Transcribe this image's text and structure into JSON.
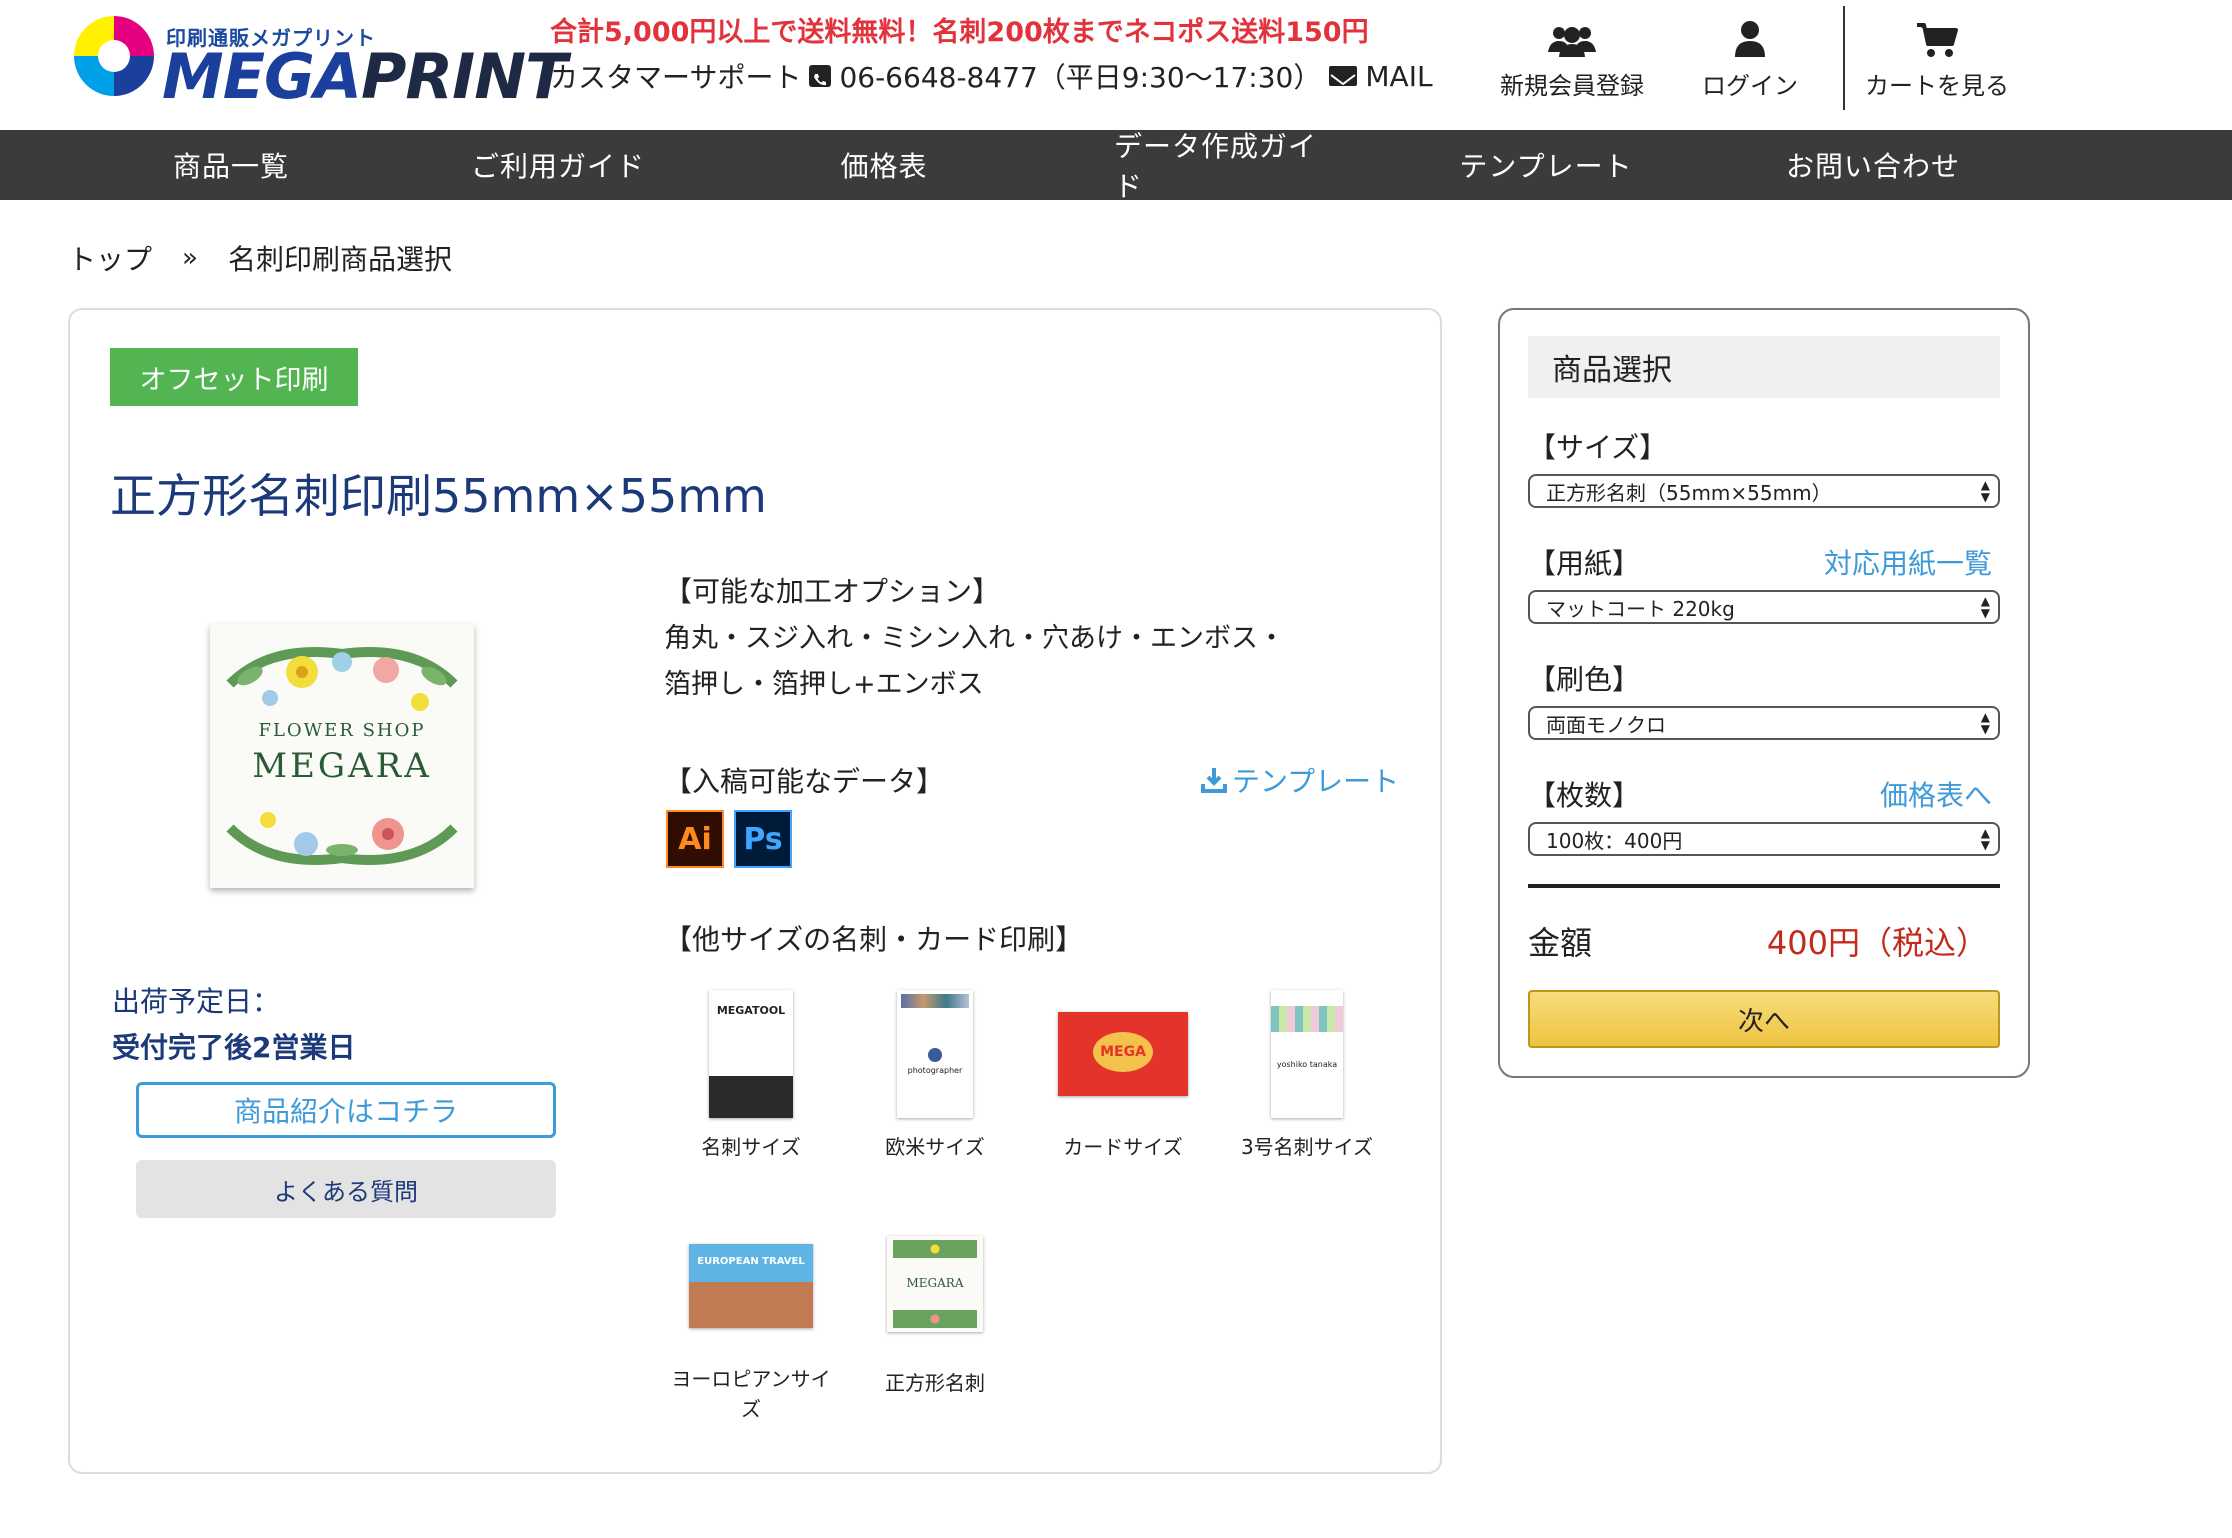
{
  "header": {
    "logo_tagline": "印刷通販メガプリント",
    "logo_mega": "MEGA",
    "logo_print": "PRINT",
    "promo": "合計5,000円以上で送料無料！名刺200枚までネコポス送料150円",
    "support_label": "カスタマーサポート",
    "phone": "06-6648-8477（平日9:30〜17:30）",
    "mail": "MAIL",
    "register": "新規会員登録",
    "login": "ログイン",
    "cart": "カートを見る"
  },
  "nav": [
    "商品一覧",
    "ご利用ガイド",
    "価格表",
    "データ作成ガイド",
    "テンプレート",
    "お問い合わせ"
  ],
  "breadcrumb": {
    "home": "トップ",
    "sep": "»",
    "current": "名刺印刷商品選択"
  },
  "product": {
    "badge": "オフセット印刷",
    "title": "正方形名刺印刷55mm×55mm",
    "hero_text1": "FLOWER SHOP",
    "hero_text2": "MEGARA",
    "ship_label": "出荷予定日：",
    "ship_value": "受付完了後2営業日",
    "intro_button": "商品紹介はコチラ",
    "faq_button": "よくある質問",
    "options_heading": "【可能な加工オプション】",
    "options_line1": "角丸・スジ入れ・ミシン入れ・穴あけ・エンボス・",
    "options_line2": "箔押し・箔押し+エンボス",
    "data_heading": "【入稿可能なデータ】",
    "template_link": "テンプレート",
    "ai_label": "Ai",
    "ps_label": "Ps",
    "other_heading": "【他サイズの名刺・カード印刷】",
    "other_sizes": [
      {
        "label": "名刺サイズ",
        "thumb_text": "MEGATOOL"
      },
      {
        "label": "欧米サイズ",
        "thumb_text": "photographer"
      },
      {
        "label": "カードサイズ",
        "thumb_text": "MEGA"
      },
      {
        "label": "3号名刺サイズ",
        "thumb_text": "yoshiko tanaka"
      },
      {
        "label": "ヨーロピアンサイズ",
        "thumb_text": "EUROPEAN TRAVEL"
      },
      {
        "label": "正方形名刺",
        "thumb_text": "MEGARA"
      }
    ]
  },
  "side": {
    "title": "商品選択",
    "size_label": "【サイズ】",
    "size_value": "正方形名刺（55mm×55mm）",
    "paper_label": "【用紙】",
    "paper_link": "対応用紙一覧",
    "paper_value": "マットコート 220kg",
    "color_label": "【刷色】",
    "color_value": "両面モノクロ",
    "qty_label": "【枚数】",
    "qty_link": "価格表へ",
    "qty_value": "100枚：400円",
    "total_label": "金額",
    "total_value": "400円（税込）",
    "next_button": "次へ"
  },
  "colors": {
    "nav_bg": "#3b3b3b",
    "badge_green": "#52b552",
    "title_blue": "#1c3a7a",
    "link_blue": "#3e9ad8",
    "promo_red": "#e2333c",
    "price_red": "#c22b1b",
    "button_gold": "#eec340"
  }
}
